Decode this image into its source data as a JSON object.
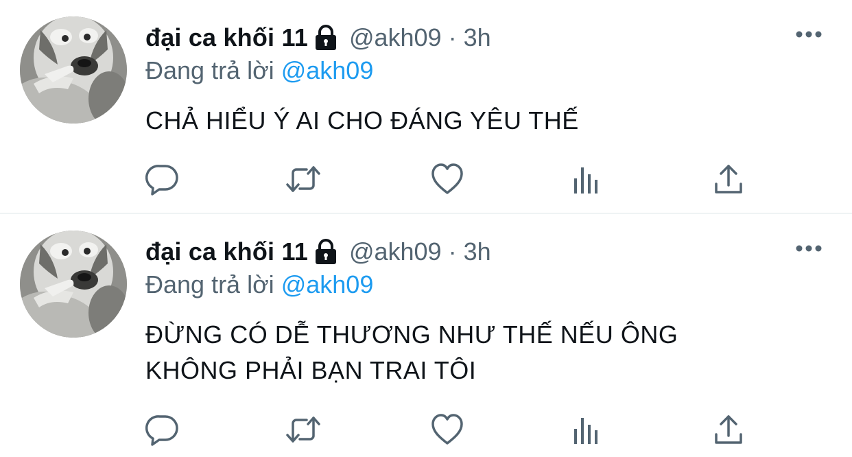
{
  "tweets": [
    {
      "display_name": "đại ca khối 11",
      "handle": "@akh09",
      "separator": "·",
      "time": "3h",
      "reply_prefix": "Đang trả lời",
      "reply_to": "@akh09",
      "text_lines": [
        "CHẢ HIỂU Ý AI CHO ĐÁNG YÊU THẾ"
      ],
      "icons": {
        "lock": "lock-icon",
        "more": "more-dots-icon",
        "reply": "reply-icon",
        "retweet": "retweet-icon",
        "like": "heart-icon",
        "views": "views-icon",
        "share": "share-icon"
      }
    },
    {
      "display_name": "đại ca khối 11",
      "handle": "@akh09",
      "separator": "·",
      "time": "3h",
      "reply_prefix": "Đang trả lời",
      "reply_to": "@akh09",
      "text_lines": [
        "ĐỪNG CÓ DỄ THƯƠNG NHƯ THẾ NẾU ÔNG",
        "KHÔNG PHẢI BẠN TRAI TÔI"
      ],
      "icons": {
        "lock": "lock-icon",
        "more": "more-dots-icon",
        "reply": "reply-icon",
        "retweet": "retweet-icon",
        "like": "heart-icon",
        "views": "views-icon",
        "share": "share-icon"
      }
    }
  ],
  "colors": {
    "text_primary": "#0f1419",
    "text_secondary": "#536471",
    "link": "#1d9bf0",
    "divider": "#eff3f4"
  }
}
